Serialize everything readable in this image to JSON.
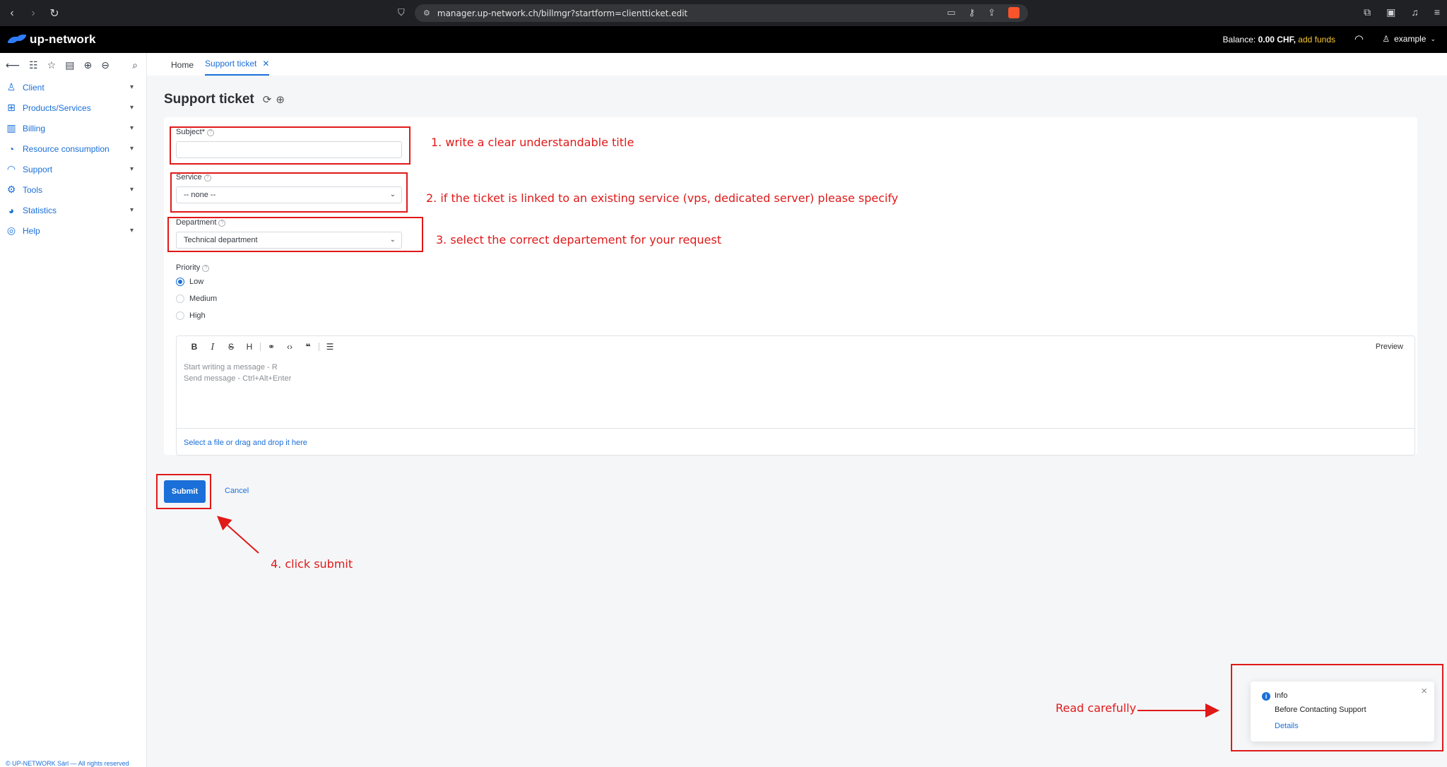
{
  "browser": {
    "url": "manager.up-network.ch/billmgr?startform=clientticket.edit"
  },
  "header": {
    "brand": "up-network",
    "balance_label": "Balance:",
    "balance_value": "0.00 CHF,",
    "add_funds": "add funds",
    "user": "example"
  },
  "sidebar": {
    "items": [
      {
        "label": "Client",
        "icon": "user-icon"
      },
      {
        "label": "Products/Services",
        "icon": "basket-icon"
      },
      {
        "label": "Billing",
        "icon": "wallet-icon"
      },
      {
        "label": "Resource consumption",
        "icon": "pie-chart-icon"
      },
      {
        "label": "Support",
        "icon": "headset-icon"
      },
      {
        "label": "Tools",
        "icon": "gear-icon"
      },
      {
        "label": "Statistics",
        "icon": "chart-icon"
      },
      {
        "label": "Help",
        "icon": "lifebuoy-icon"
      }
    ],
    "copyright": "© UP-NETWORK Sàrl — All rights reserved"
  },
  "tabs": {
    "home": "Home",
    "support_ticket": "Support ticket"
  },
  "page": {
    "title": "Support ticket"
  },
  "form": {
    "subject_label": "Subject*",
    "subject_value": "",
    "service_label": "Service",
    "service_value": "-- none --",
    "department_label": "Department",
    "department_value": "Technical department",
    "priority_label": "Priority",
    "priority_options": [
      "Low",
      "Medium",
      "High"
    ],
    "priority_selected": "Low",
    "preview": "Preview",
    "placeholder": "Start writing a message - R\nSend message - Ctrl+Alt+Enter",
    "attach": "Select a file or drag and drop it here",
    "submit": "Submit",
    "cancel": "Cancel"
  },
  "annotations": {
    "note1": "1. write a clear understandable title",
    "note2": "2. if the ticket is linked to an existing service (vps, dedicated server) please specify",
    "note3": "3. select the correct departement for your request",
    "note4": "4. click submit",
    "note5": "Read carefully"
  },
  "toast": {
    "title": "Info",
    "message": "Before Contacting Support",
    "link": "Details"
  },
  "colors": {
    "accent": "#1a6fd8",
    "annotation": "#e01919",
    "header_bg": "#000000"
  }
}
